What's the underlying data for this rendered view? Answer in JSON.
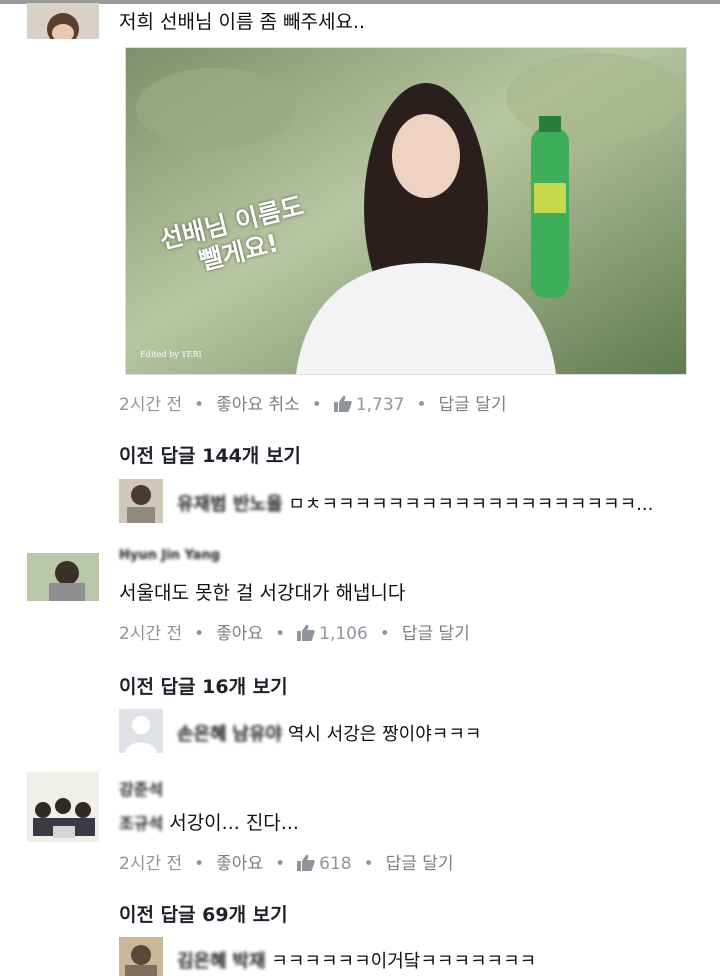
{
  "comments": [
    {
      "text": "저희 선배님 이름 좀 빼주세요..",
      "photo_overlay": [
        "선배님 이름도",
        "뺄게요!"
      ],
      "photo_credit": "Edited by YERI",
      "time": "2시간 전",
      "like_label": "좋아요 취소",
      "like_count": "1,737",
      "reply_label": "답글 달기",
      "prev_replies": "이전 답글 144개 보기",
      "reply_preview": {
        "name": "유재범 반노을",
        "text": "ㅁㅊㅋㅋㅋㅋㅋㅋㅋㅋㅋㅋㅋㅋㅋㅋㅋㅋㅋㅋㅋ..."
      }
    },
    {
      "author": "Hyun Jin Yang",
      "text": "서울대도 못한 걸 서강대가 해냅니다",
      "time": "2시간 전",
      "like_label": "좋아요",
      "like_count": "1,106",
      "reply_label": "답글 달기",
      "prev_replies": "이전 답글 16개 보기",
      "reply_preview": {
        "name": "손은혜",
        "mention": "남유야",
        "text": "역시 서강은 짱이야ㅋㅋㅋ"
      }
    },
    {
      "author": "강준석",
      "mention": "조규석",
      "text": "서강이... 진다...",
      "time": "2시간 전",
      "like_label": "좋아요",
      "like_count": "618",
      "reply_label": "답글 달기",
      "prev_replies": "이전 답글 69개 보기",
      "reply_preview": {
        "name": "김은혜",
        "mention": "박재",
        "text": "ㅋㅋㅋㅋㅋㅋ이거닼ㅋㅋㅋㅋㅋㅋㅋ"
      }
    }
  ],
  "colors": {
    "meta": "#90949c",
    "like_active": "#7f7f7f",
    "text": "#111111"
  }
}
